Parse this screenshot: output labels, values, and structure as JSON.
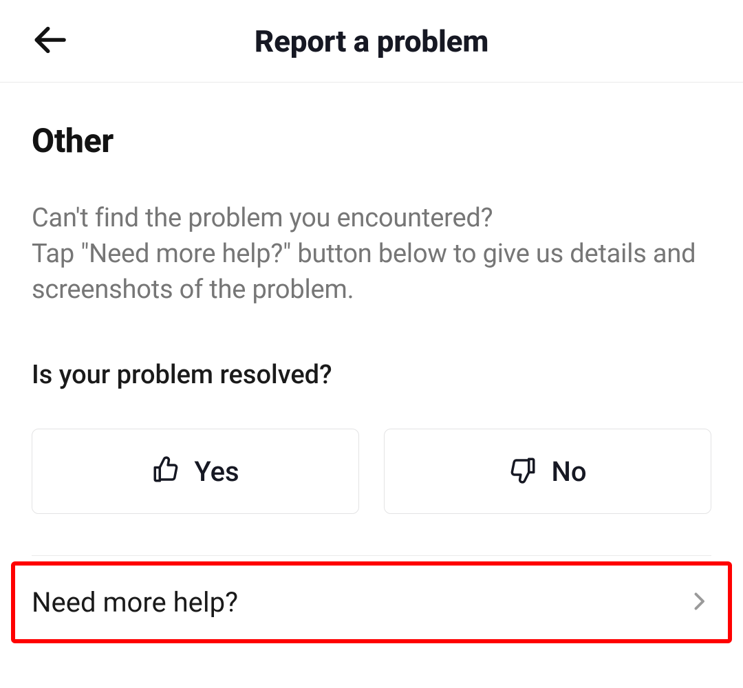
{
  "header": {
    "title": "Report a problem"
  },
  "main": {
    "section_title": "Other",
    "description": "Can't find the problem you encountered?\nTap \"Need more help?\" button below to give us details and screenshots of the problem.",
    "question": "Is your problem resolved?",
    "yes_label": "Yes",
    "no_label": "No",
    "help_label": "Need more help?"
  },
  "colors": {
    "highlight_border": "#ff0000",
    "text_primary": "#161823",
    "text_secondary": "#767676",
    "border": "#e3e3e4"
  }
}
